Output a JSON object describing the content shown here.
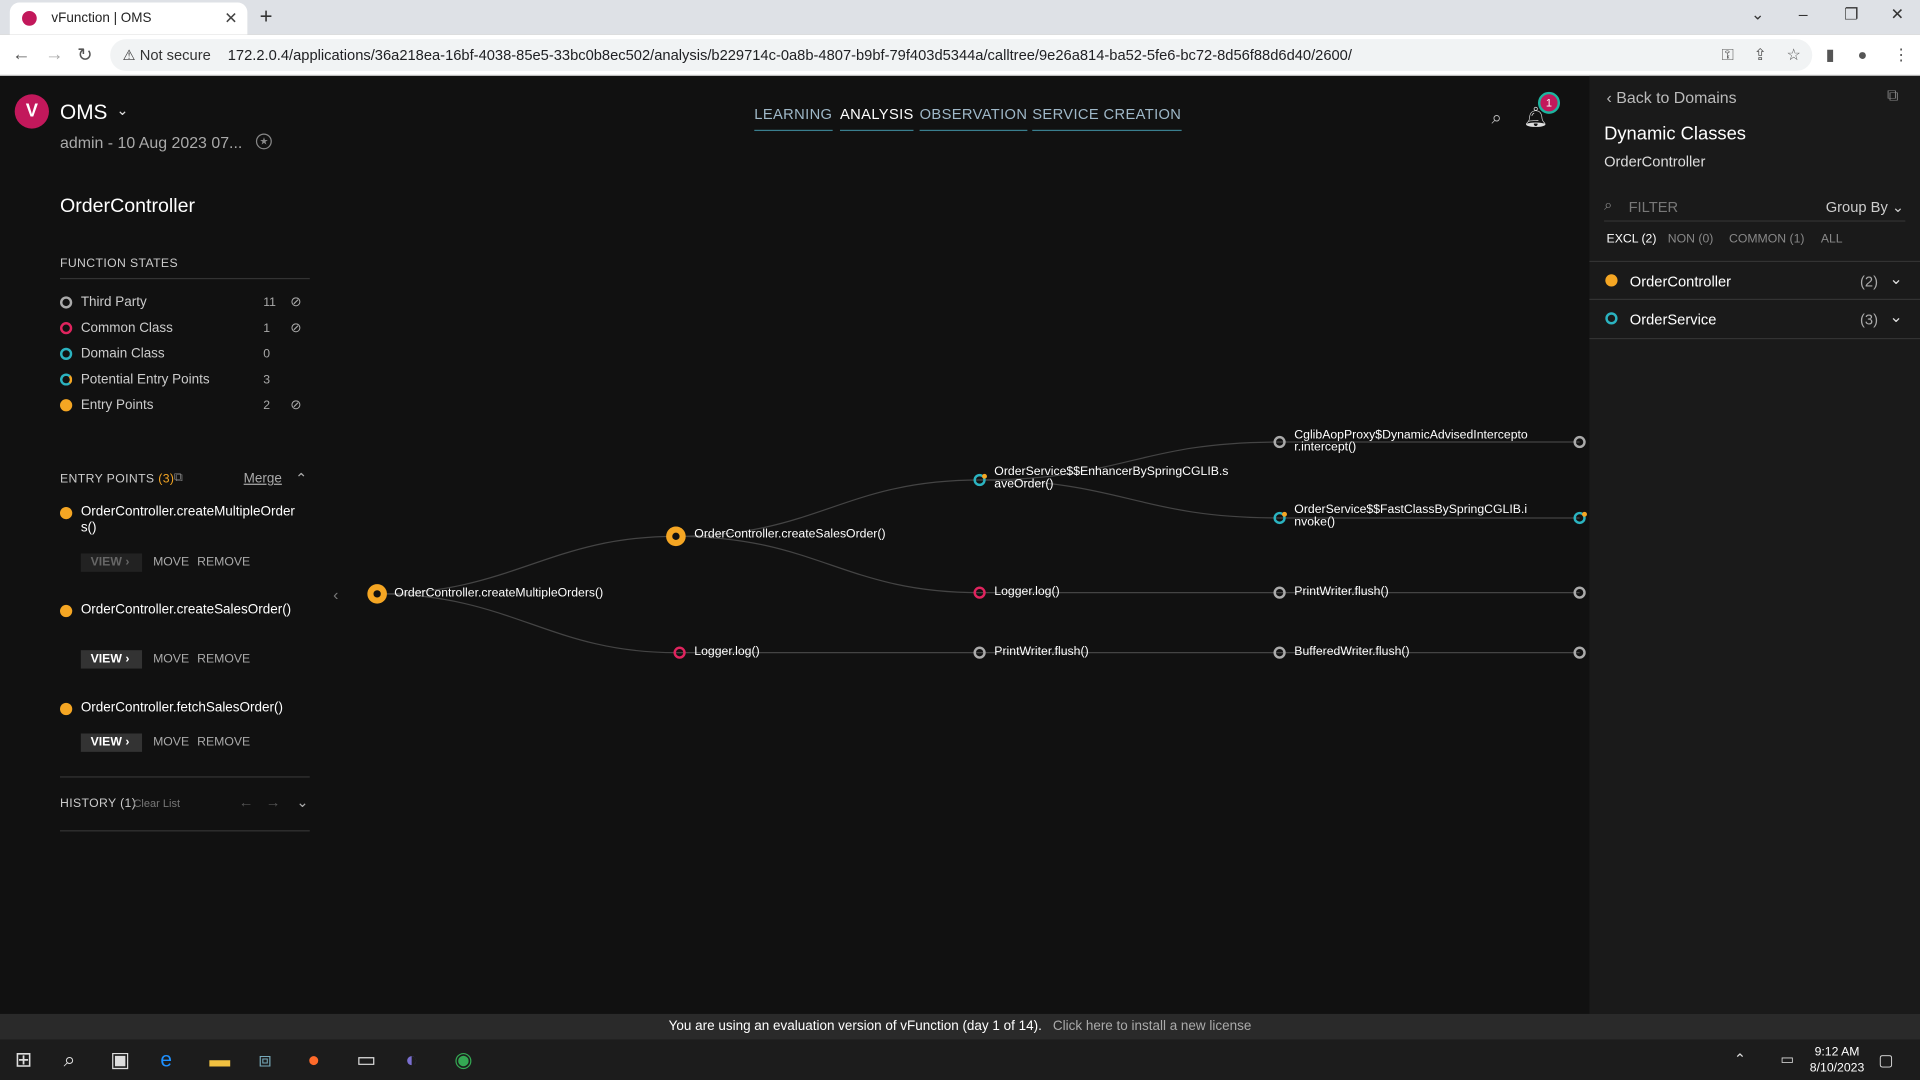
{
  "browser": {
    "tab_title": "vFunction | OMS",
    "not_secure": "Not secure",
    "url": "172.2.0.4/applications/36a218ea-16bf-4038-85e5-33bc0b8ec502/analysis/b229714c-0a8b-4807-b9bf-79f403d5344a/calltree/9e26a814-ba52-5fe6-bc72-8d56f88d6d40/2600/"
  },
  "header": {
    "app_name": "OMS",
    "subtitle": "admin - 10 Aug 2023 07...",
    "nav_tabs": [
      "LEARNING",
      "ANALYSIS",
      "OBSERVATION",
      "SERVICE CREATION"
    ],
    "active_tab": "ANALYSIS",
    "notification_count": "1"
  },
  "left_panel": {
    "title": "OrderController",
    "function_states_label": "FUNCTION STATES",
    "function_states": [
      {
        "label": "Third Party",
        "count": "11",
        "color": "#aaaaaa",
        "hidden": true
      },
      {
        "label": "Common Class",
        "count": "1",
        "color": "#e0245e",
        "hidden": true
      },
      {
        "label": "Domain Class",
        "count": "0",
        "color": "#2bb3c0",
        "hidden": false
      },
      {
        "label": "Potential Entry Points",
        "count": "3",
        "color": "#2bb3c0",
        "hidden": false
      },
      {
        "label": "Entry Points",
        "count": "2",
        "color": "#f5a623",
        "hidden": true
      }
    ],
    "entry_points_label": "ENTRY POINTS",
    "entry_points_count": "(3)",
    "merge_label": "Merge",
    "entry_points": [
      {
        "name": "OrderController.createMultipleOrders()",
        "view": "VIEW",
        "move": "MOVE",
        "remove": "REMOVE",
        "view_disabled": true
      },
      {
        "name": "OrderController.createSalesOrder()",
        "view": "VIEW",
        "move": "MOVE",
        "remove": "REMOVE",
        "view_disabled": false
      },
      {
        "name": "OrderController.fetchSalesOrder()",
        "view": "VIEW",
        "move": "MOVE",
        "remove": "REMOVE",
        "view_disabled": false
      }
    ],
    "history_label": "HISTORY (1)",
    "clear_list": "Clear List"
  },
  "call_tree": {
    "nodes": [
      {
        "id": "n1",
        "label": "OrderController.createMultipleOrders()",
        "type": "entry"
      },
      {
        "id": "n2",
        "label": "OrderController.createSalesOrder()",
        "type": "entry"
      },
      {
        "id": "n3",
        "label": "Logger.log()",
        "type": "common"
      },
      {
        "id": "n4",
        "label": "OrderService$$EnhancerBySpringCGLIB.saveOrder()",
        "type": "potential"
      },
      {
        "id": "n5",
        "label": "Logger.log()",
        "type": "common"
      },
      {
        "id": "n6",
        "label": "PrintWriter.flush()",
        "type": "third"
      },
      {
        "id": "n7",
        "label": "CglibAopProxy$DynamicAdvisedInterceptor.intercept()",
        "type": "third"
      },
      {
        "id": "n8",
        "label": "OrderService$$FastClassBySpringCGLIB.invoke()",
        "type": "potential"
      },
      {
        "id": "n9",
        "label": "PrintWriter.flush()",
        "type": "third"
      },
      {
        "id": "n10",
        "label": "BufferedWriter.flush()",
        "type": "third"
      }
    ]
  },
  "right_panel": {
    "back_label": "Back to Domains",
    "title": "Dynamic Classes",
    "subtitle": "OrderController",
    "filter_placeholder": "FILTER",
    "group_by": "Group By",
    "tabs": [
      "EXCL (2)",
      "NON (0)",
      "COMMON (1)",
      "ALL"
    ],
    "active_tab": "EXCL (2)",
    "classes": [
      {
        "name": "OrderController",
        "count": "(2)",
        "color": "#f5a623"
      },
      {
        "name": "OrderService",
        "count": "(3)",
        "color": "#2bb3c0"
      }
    ]
  },
  "footer": {
    "eval_text": "You are using an evaluation version of vFunction (day 1 of 14).",
    "eval_link": "Click here to install a new license"
  },
  "taskbar": {
    "time": "9:12 AM",
    "date": "8/10/2023"
  },
  "colors": {
    "entry": "#f5a623",
    "common": "#e0245e",
    "domain": "#2bb3c0",
    "third": "#aaaaaa",
    "brand": "#c2185b"
  }
}
